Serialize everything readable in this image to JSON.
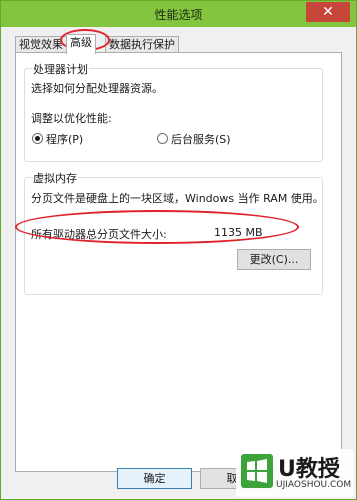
{
  "window": {
    "title": "性能选项",
    "close_glyph": "✕"
  },
  "tabs": [
    {
      "label": "视觉效果",
      "active": false
    },
    {
      "label": "高级",
      "active": true
    },
    {
      "label": "数据执行保护",
      "active": false
    }
  ],
  "processor_scheduling": {
    "title": "处理器计划",
    "description": "选择如何分配处理器资源。",
    "adjust_label": "调整以优化性能:",
    "options": [
      {
        "label": "程序(P)",
        "checked": true
      },
      {
        "label": "后台服务(S)",
        "checked": false
      }
    ]
  },
  "virtual_memory": {
    "title": "虚拟内存",
    "description": "分页文件是硬盘上的一块区域，Windows 当作 RAM 使用。",
    "total_label": "所有驱动器总分页文件大小:",
    "total_value": "1135 MB",
    "change_button": "更改(C)..."
  },
  "dialog_buttons": {
    "ok": "确定",
    "cancel": "取消"
  },
  "watermark": {
    "brand": "U教授",
    "url": "UJIAOSHOU.COM"
  },
  "colors": {
    "titlebar": "#83c53f",
    "annotation": "#e0202a",
    "close_button": "#c7463a"
  }
}
